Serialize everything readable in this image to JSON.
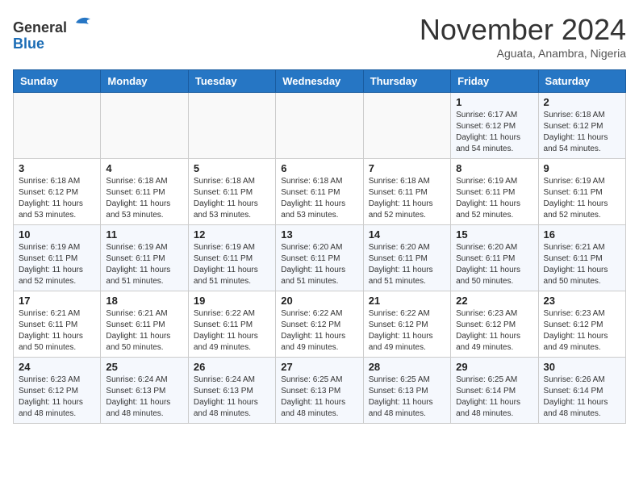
{
  "header": {
    "logo_line1": "General",
    "logo_line2": "Blue",
    "month": "November 2024",
    "location": "Aguata, Anambra, Nigeria"
  },
  "weekdays": [
    "Sunday",
    "Monday",
    "Tuesday",
    "Wednesday",
    "Thursday",
    "Friday",
    "Saturday"
  ],
  "weeks": [
    [
      {
        "day": "",
        "info": ""
      },
      {
        "day": "",
        "info": ""
      },
      {
        "day": "",
        "info": ""
      },
      {
        "day": "",
        "info": ""
      },
      {
        "day": "",
        "info": ""
      },
      {
        "day": "1",
        "info": "Sunrise: 6:17 AM\nSunset: 6:12 PM\nDaylight: 11 hours\nand 54 minutes."
      },
      {
        "day": "2",
        "info": "Sunrise: 6:18 AM\nSunset: 6:12 PM\nDaylight: 11 hours\nand 54 minutes."
      }
    ],
    [
      {
        "day": "3",
        "info": "Sunrise: 6:18 AM\nSunset: 6:12 PM\nDaylight: 11 hours\nand 53 minutes."
      },
      {
        "day": "4",
        "info": "Sunrise: 6:18 AM\nSunset: 6:11 PM\nDaylight: 11 hours\nand 53 minutes."
      },
      {
        "day": "5",
        "info": "Sunrise: 6:18 AM\nSunset: 6:11 PM\nDaylight: 11 hours\nand 53 minutes."
      },
      {
        "day": "6",
        "info": "Sunrise: 6:18 AM\nSunset: 6:11 PM\nDaylight: 11 hours\nand 53 minutes."
      },
      {
        "day": "7",
        "info": "Sunrise: 6:18 AM\nSunset: 6:11 PM\nDaylight: 11 hours\nand 52 minutes."
      },
      {
        "day": "8",
        "info": "Sunrise: 6:19 AM\nSunset: 6:11 PM\nDaylight: 11 hours\nand 52 minutes."
      },
      {
        "day": "9",
        "info": "Sunrise: 6:19 AM\nSunset: 6:11 PM\nDaylight: 11 hours\nand 52 minutes."
      }
    ],
    [
      {
        "day": "10",
        "info": "Sunrise: 6:19 AM\nSunset: 6:11 PM\nDaylight: 11 hours\nand 52 minutes."
      },
      {
        "day": "11",
        "info": "Sunrise: 6:19 AM\nSunset: 6:11 PM\nDaylight: 11 hours\nand 51 minutes."
      },
      {
        "day": "12",
        "info": "Sunrise: 6:19 AM\nSunset: 6:11 PM\nDaylight: 11 hours\nand 51 minutes."
      },
      {
        "day": "13",
        "info": "Sunrise: 6:20 AM\nSunset: 6:11 PM\nDaylight: 11 hours\nand 51 minutes."
      },
      {
        "day": "14",
        "info": "Sunrise: 6:20 AM\nSunset: 6:11 PM\nDaylight: 11 hours\nand 51 minutes."
      },
      {
        "day": "15",
        "info": "Sunrise: 6:20 AM\nSunset: 6:11 PM\nDaylight: 11 hours\nand 50 minutes."
      },
      {
        "day": "16",
        "info": "Sunrise: 6:21 AM\nSunset: 6:11 PM\nDaylight: 11 hours\nand 50 minutes."
      }
    ],
    [
      {
        "day": "17",
        "info": "Sunrise: 6:21 AM\nSunset: 6:11 PM\nDaylight: 11 hours\nand 50 minutes."
      },
      {
        "day": "18",
        "info": "Sunrise: 6:21 AM\nSunset: 6:11 PM\nDaylight: 11 hours\nand 50 minutes."
      },
      {
        "day": "19",
        "info": "Sunrise: 6:22 AM\nSunset: 6:11 PM\nDaylight: 11 hours\nand 49 minutes."
      },
      {
        "day": "20",
        "info": "Sunrise: 6:22 AM\nSunset: 6:12 PM\nDaylight: 11 hours\nand 49 minutes."
      },
      {
        "day": "21",
        "info": "Sunrise: 6:22 AM\nSunset: 6:12 PM\nDaylight: 11 hours\nand 49 minutes."
      },
      {
        "day": "22",
        "info": "Sunrise: 6:23 AM\nSunset: 6:12 PM\nDaylight: 11 hours\nand 49 minutes."
      },
      {
        "day": "23",
        "info": "Sunrise: 6:23 AM\nSunset: 6:12 PM\nDaylight: 11 hours\nand 49 minutes."
      }
    ],
    [
      {
        "day": "24",
        "info": "Sunrise: 6:23 AM\nSunset: 6:12 PM\nDaylight: 11 hours\nand 48 minutes."
      },
      {
        "day": "25",
        "info": "Sunrise: 6:24 AM\nSunset: 6:13 PM\nDaylight: 11 hours\nand 48 minutes."
      },
      {
        "day": "26",
        "info": "Sunrise: 6:24 AM\nSunset: 6:13 PM\nDaylight: 11 hours\nand 48 minutes."
      },
      {
        "day": "27",
        "info": "Sunrise: 6:25 AM\nSunset: 6:13 PM\nDaylight: 11 hours\nand 48 minutes."
      },
      {
        "day": "28",
        "info": "Sunrise: 6:25 AM\nSunset: 6:13 PM\nDaylight: 11 hours\nand 48 minutes."
      },
      {
        "day": "29",
        "info": "Sunrise: 6:25 AM\nSunset: 6:14 PM\nDaylight: 11 hours\nand 48 minutes."
      },
      {
        "day": "30",
        "info": "Sunrise: 6:26 AM\nSunset: 6:14 PM\nDaylight: 11 hours\nand 48 minutes."
      }
    ]
  ]
}
